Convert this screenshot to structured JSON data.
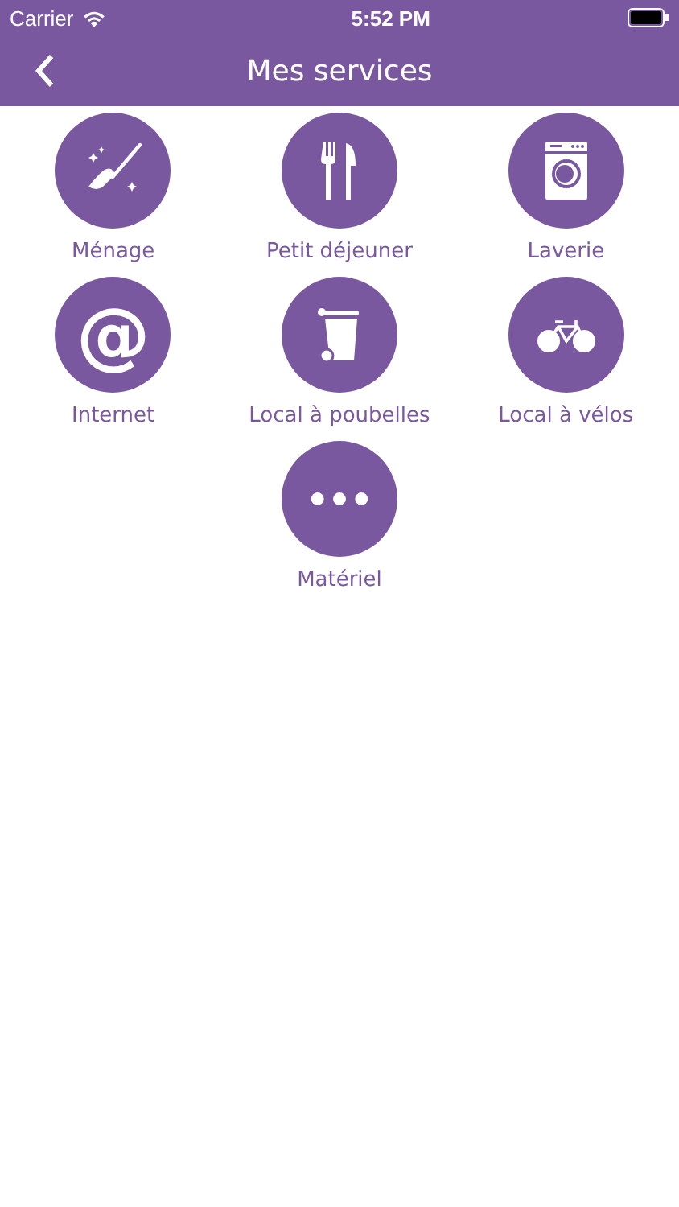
{
  "status_bar": {
    "carrier": "Carrier",
    "time": "5:52 PM"
  },
  "nav_bar": {
    "title": "Mes services"
  },
  "services": [
    {
      "label": "Ménage",
      "kind": "broom"
    },
    {
      "label": "Petit déjeuner",
      "kind": "cutlery"
    },
    {
      "label": "Laverie",
      "kind": "washer"
    },
    {
      "label": "Internet",
      "kind": "glyph",
      "glyph": "@"
    },
    {
      "label": "Local à poubelles",
      "kind": "bin"
    },
    {
      "label": "Local à vélos",
      "kind": "bike"
    },
    {
      "label": "Matériel",
      "kind": "dots"
    }
  ]
}
